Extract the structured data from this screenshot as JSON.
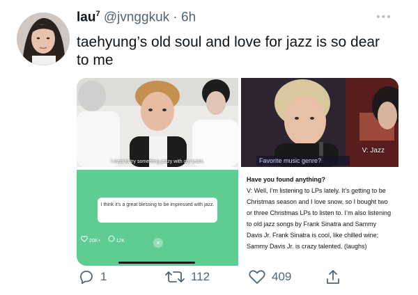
{
  "tweet": {
    "display_name": "lau",
    "name_superscript": "7",
    "handle": "@jvnggkuk",
    "separator": "·",
    "time": "6h",
    "more_label": "•••",
    "text": "taehyung’s old soul and love for jazz is so dear to me"
  },
  "media": {
    "clip1_caption": "I want to try something jazzy with our team.",
    "clip2_label": "Favorite music genre?",
    "clip2_tag": "V: Jazz",
    "clip3_quote": "I think it's a great blessing to be impressed with jazz.",
    "clip3_likes": "20K+",
    "clip3_comments": "12K",
    "clip3_close": "×",
    "interview_question": "Have you found anything?",
    "interview_answer": "V: Well, I’m listening to LPs lately. It’s getting to be Christmas season and I love snow, so I bought two or three Christmas LPs to listen to. I’m also listening to old jazz songs by Frank Sinatra and Sammy Davis Jr. Frank Sinatra is cool, like chilled wine; Sammy Davis Jr. is crazy talented. (laughs)"
  },
  "actions": {
    "replies": "1",
    "retweets": "112",
    "likes": "409"
  },
  "colors": {
    "text": "#0f1419",
    "muted": "#536471",
    "clip3_bg": "#5fcc93"
  },
  "icons": [
    "reply-icon",
    "retweet-icon",
    "like-icon",
    "share-icon"
  ]
}
